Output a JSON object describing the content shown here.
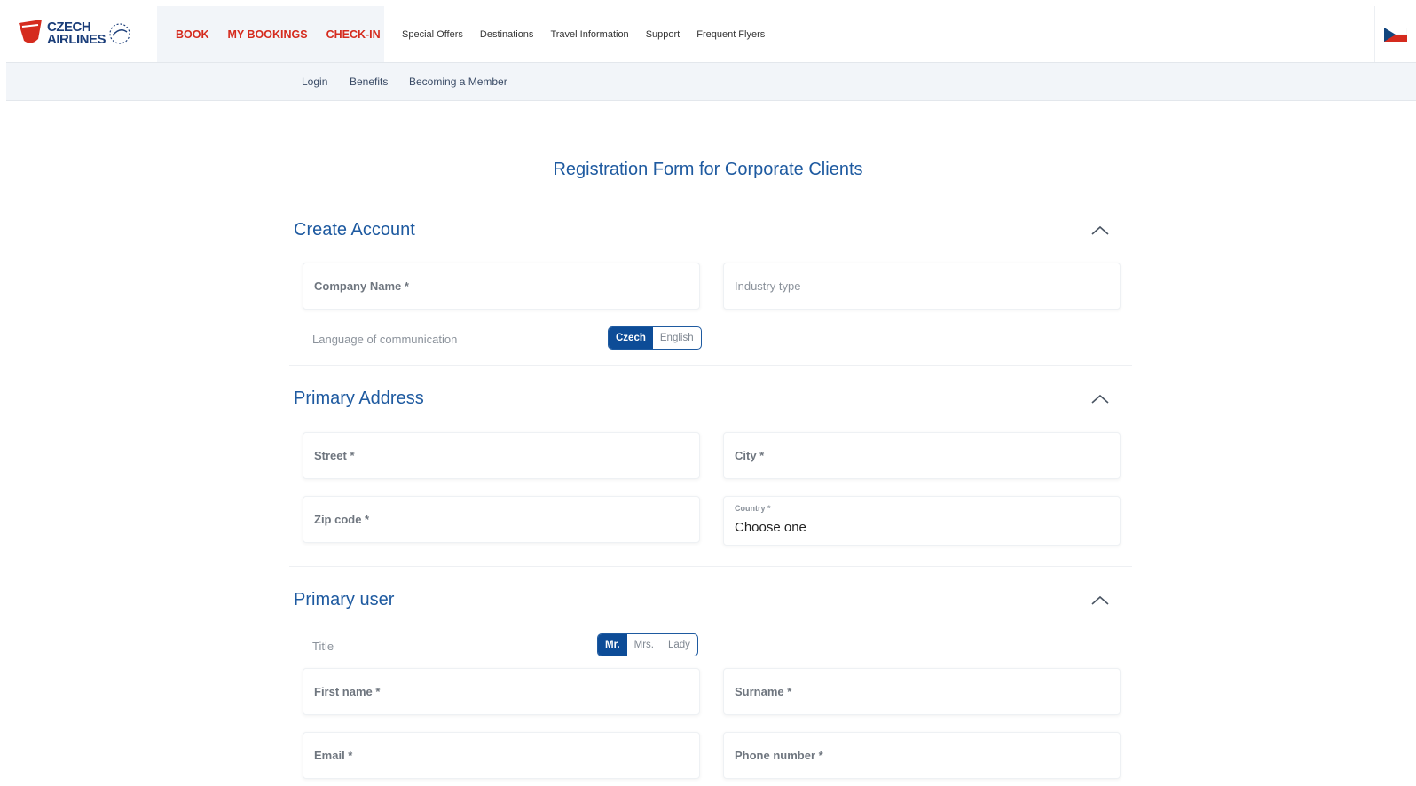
{
  "brand": {
    "line1": "CZECH",
    "line2": "AIRLINES",
    "badge": "ČSA",
    "logo_color": "#d52b1e",
    "text_color": "#1b3e7a"
  },
  "main_nav": [
    {
      "label": "BOOK"
    },
    {
      "label": "MY BOOKINGS"
    },
    {
      "label": "CHECK-IN"
    }
  ],
  "sub_nav": [
    {
      "label": "Special Offers"
    },
    {
      "label": "Destinations"
    },
    {
      "label": "Travel Information"
    },
    {
      "label": "Support"
    },
    {
      "label": "Frequent Flyers"
    }
  ],
  "secondary_nav": [
    {
      "label": "Login"
    },
    {
      "label": "Benefits"
    },
    {
      "label": "Becoming a Member"
    }
  ],
  "language_flag_icon": "czech-flag-icon",
  "form": {
    "title": "Registration Form for Corporate Clients",
    "create_account": {
      "title": "Create Account",
      "company_name": "Company Name *",
      "industry_type": "Industry type",
      "language_label": "Language of communication",
      "language_options": [
        "Czech",
        "English"
      ],
      "language_selected": "Czech"
    },
    "primary_address": {
      "title": "Primary Address",
      "street": "Street *",
      "city": "City *",
      "zip": "Zip code *",
      "country_label": "Country *",
      "country_value": "Choose one"
    },
    "primary_user": {
      "title": "Primary user",
      "title_label": "Title",
      "title_options": [
        "Mr.",
        "Mrs.",
        "Lady"
      ],
      "title_selected": "Mr.",
      "first_name": "First name *",
      "surname": "Surname *",
      "email": "Email *",
      "phone": "Phone number *"
    }
  },
  "colors": {
    "accent": "#1e5aa0",
    "nav_red": "#d52b1e",
    "toggle_active": "#0d4c97"
  }
}
